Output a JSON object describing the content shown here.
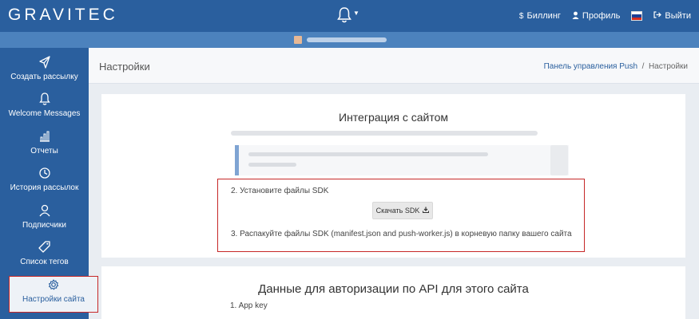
{
  "topbar": {
    "logo": "GRAVITEC",
    "billing": "Биллинг",
    "billing_icon": "dollar-icon",
    "profile": "Профиль",
    "profile_icon": "user-icon",
    "logout": "Выйти",
    "logout_icon": "sign-out-icon",
    "flag_colors": [
      "#ffffff",
      "#1c3f95",
      "#d52b1e"
    ]
  },
  "sidebar": {
    "items": [
      {
        "label": "Создать рассылку",
        "icon": "paper-plane-icon"
      },
      {
        "label": "Welcome Messages",
        "icon": "bell-icon"
      },
      {
        "label": "Отчеты",
        "icon": "bar-chart-icon"
      },
      {
        "label": "История рассылок",
        "icon": "clock-icon"
      },
      {
        "label": "Подписчики",
        "icon": "users-icon"
      },
      {
        "label": "Список тегов",
        "icon": "tag-icon"
      },
      {
        "label": "Настройки сайта",
        "icon": "gear-icon",
        "active": true
      }
    ]
  },
  "header": {
    "title": "Настройки",
    "breadcrumb_link": "Панель управления Push",
    "breadcrumb_sep": "/",
    "breadcrumb_current": "Настройки"
  },
  "integration": {
    "title": "Интеграция с сайтом",
    "step2": "2. Установите файлы SDK",
    "download_button": "Скачать SDK",
    "step3": "3. Распакуйте файлы SDK (manifest.json and push-worker.js) в корневую папку вашего сайта"
  },
  "api": {
    "title": "Данные для авторизации по API для этого сайта",
    "app_key_label": "1. App key"
  },
  "colors": {
    "primary": "#2a5f9e",
    "highlight": "#c62828"
  }
}
